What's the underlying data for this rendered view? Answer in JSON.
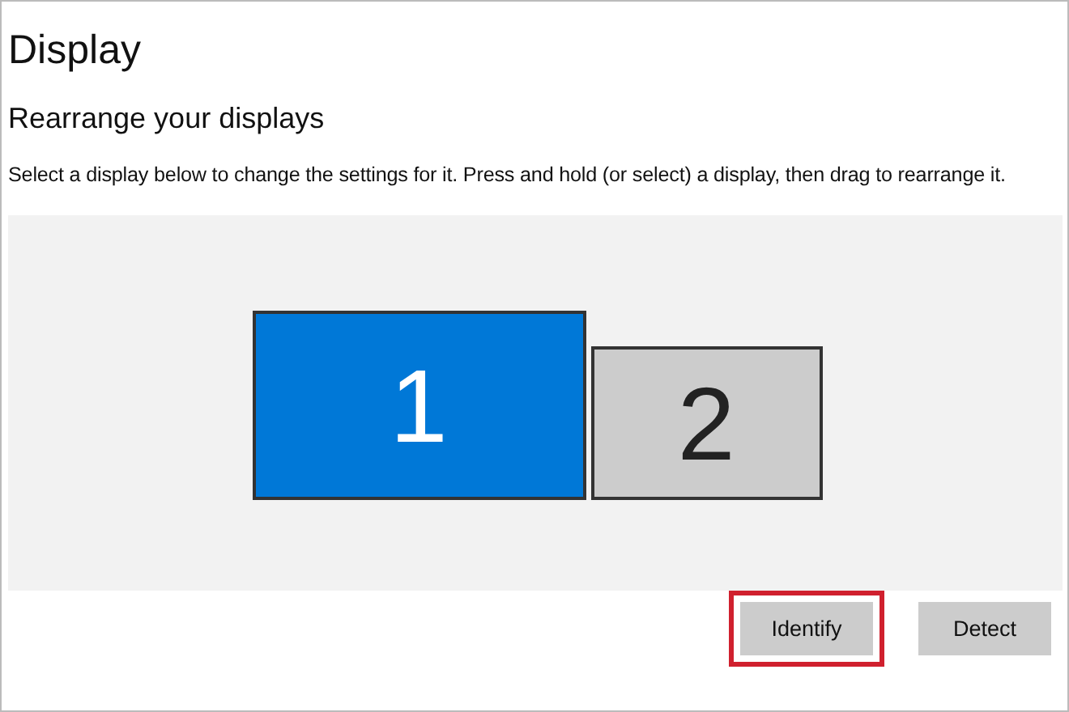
{
  "page": {
    "title": "Display"
  },
  "section": {
    "title": "Rearrange your displays",
    "description": "Select a display below to change the settings for it. Press and hold (or select) a display, then drag to rearrange it."
  },
  "displays": [
    {
      "label": "1",
      "selected": true
    },
    {
      "label": "2",
      "selected": false
    }
  ],
  "buttons": [
    {
      "label": "Identify",
      "highlighted": true
    },
    {
      "label": "Detect",
      "highlighted": false
    }
  ]
}
